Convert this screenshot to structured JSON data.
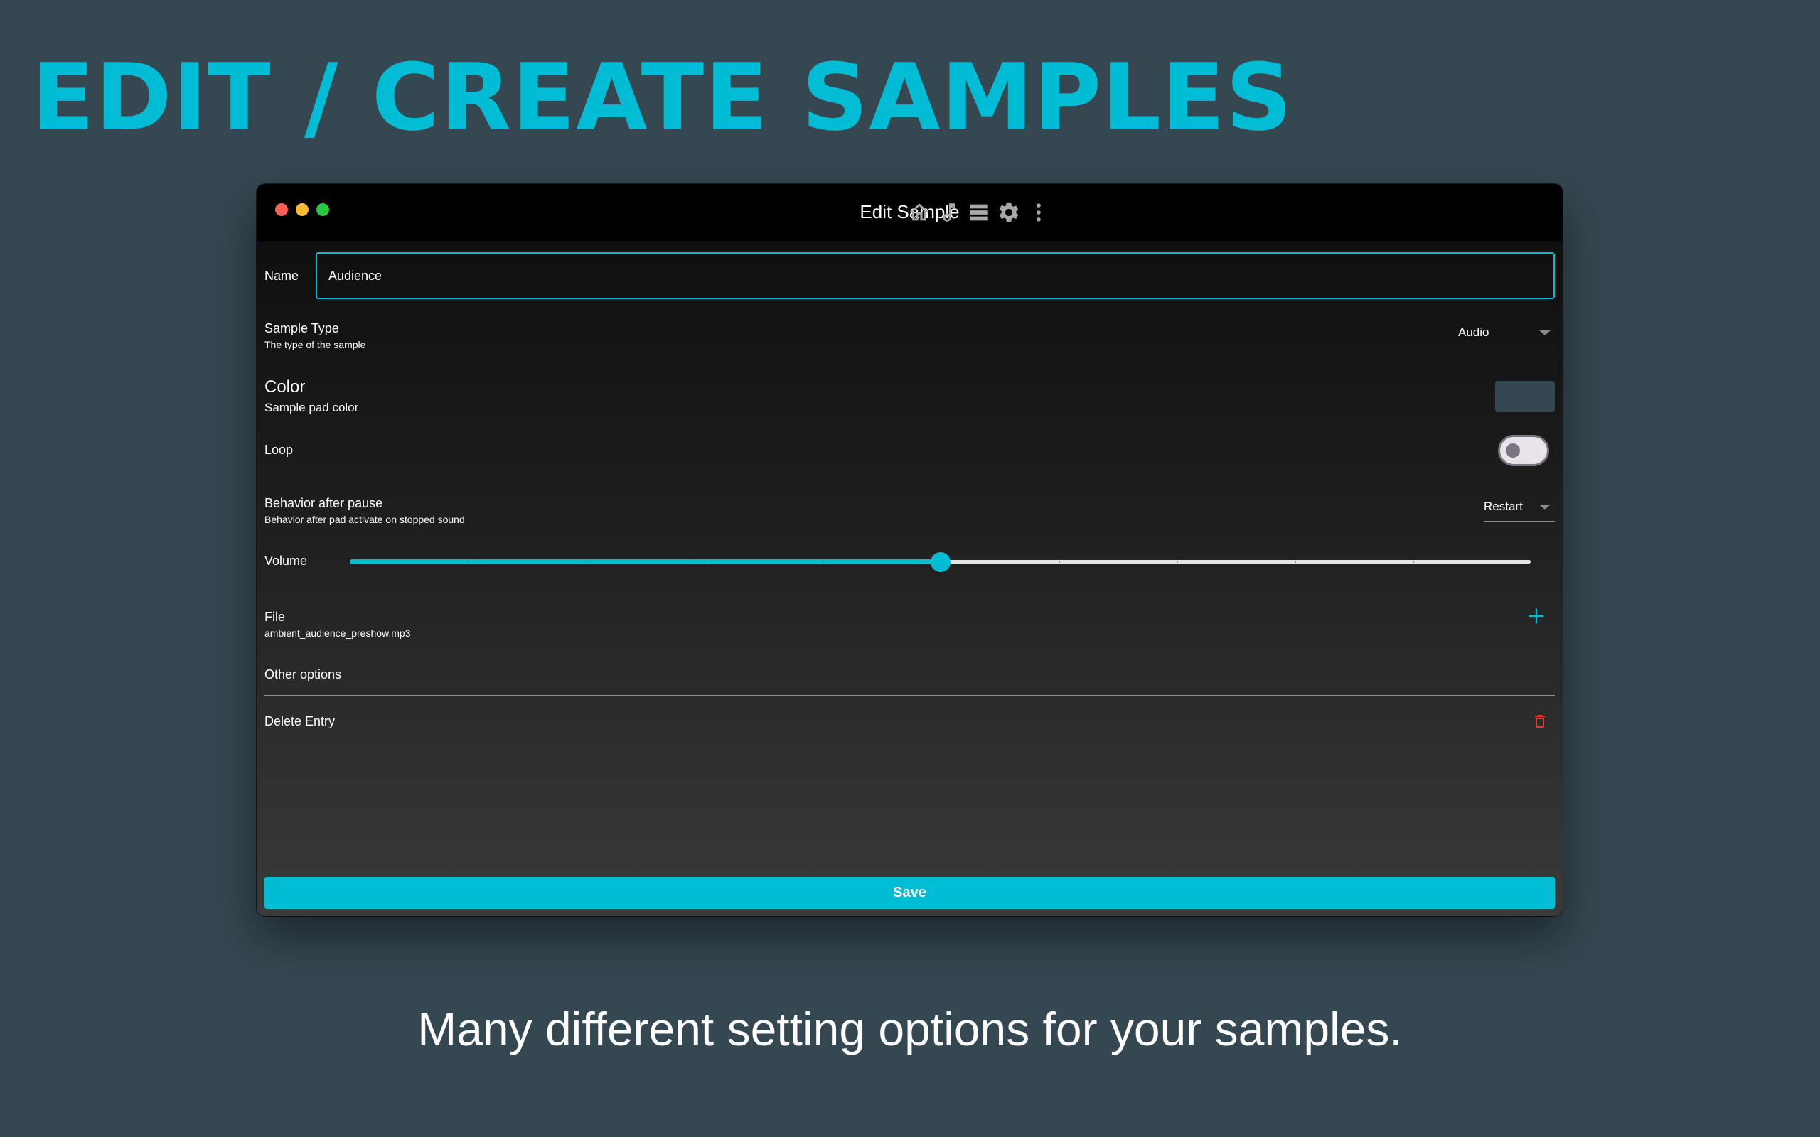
{
  "promo": {
    "headline": "EDIT / CREATE SAMPLES",
    "tagline": "Many different setting options for your samples."
  },
  "window": {
    "title": "Edit Sample",
    "toolbar_icons": [
      "home-icon",
      "music-note-icon",
      "list-icon",
      "gear-icon",
      "more-vertical-icon"
    ]
  },
  "form": {
    "name": {
      "label": "Name",
      "value": "Audience"
    },
    "sample_type": {
      "label": "Sample Type",
      "description": "The type of the sample",
      "value": "Audio"
    },
    "color": {
      "label": "Color",
      "description": "Sample pad color",
      "value": "#354750"
    },
    "loop": {
      "label": "Loop",
      "enabled": false
    },
    "behavior": {
      "label": "Behavior after pause",
      "description": "Behavior after pad activate on stopped sound",
      "value": "Restart"
    },
    "volume": {
      "label": "Volume",
      "value": 0.5
    },
    "file": {
      "label": "File",
      "value": "ambient_audience_preshow.mp3"
    },
    "other_options": {
      "label": "Other options"
    },
    "delete": {
      "label": "Delete Entry"
    },
    "save_label": "Save"
  },
  "colors": {
    "accent": "#00BCD4",
    "background": "#354750",
    "danger": "#e53935"
  }
}
